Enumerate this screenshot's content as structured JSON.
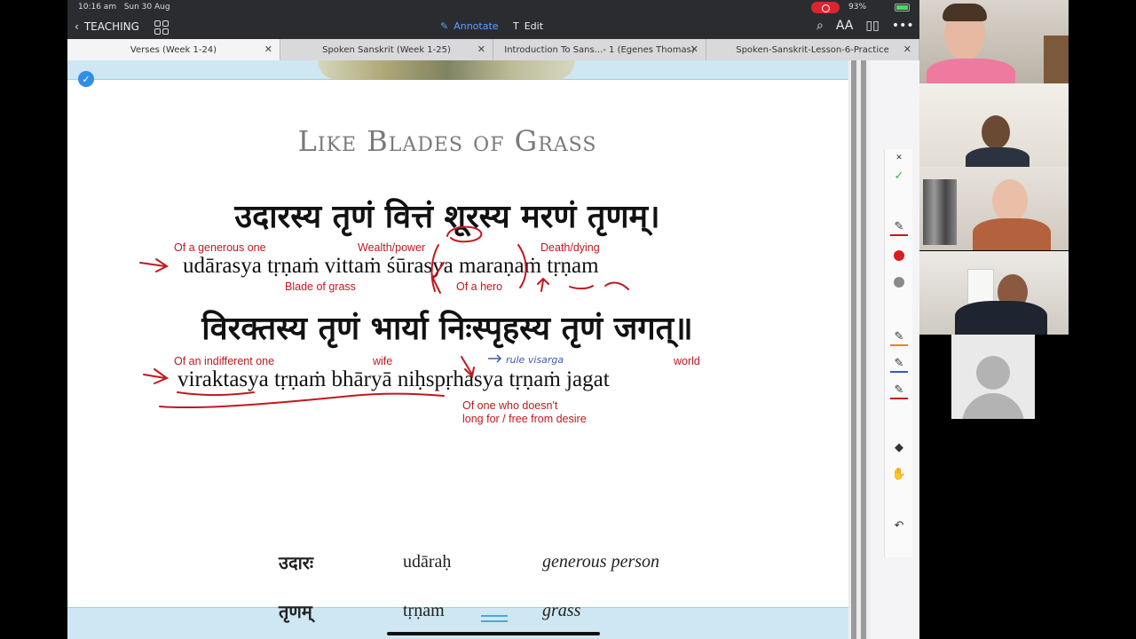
{
  "status": {
    "time": "10:16 am",
    "date": "Sun 30 Aug",
    "battery": "93%"
  },
  "toolbar": {
    "back_label": "TEACHING",
    "annotate_label": "Annotate",
    "edit_label": "Edit"
  },
  "tabs": [
    {
      "label": "Verses (Week 1-24)",
      "active": true
    },
    {
      "label": "Spoken Sanskrit (Week 1-25)",
      "active": false
    },
    {
      "label": "Introduction To Sans...- 1 (Egenes Thomas)",
      "active": false
    },
    {
      "label": "Spoken-Sanskrit-Lesson-6-Practice",
      "active": false
    }
  ],
  "page": {
    "title": "Like Blades of Grass",
    "line1_deva": "उदारस्य तृणं वित्तं शूरस्य मरणं तृणम्।",
    "line1_translit": "udārasya tṛṇaṁ vittaṁ śūrasya maraṇaṁ tṛṇam",
    "line2_deva": "विरक्तस्य तृणं भार्या निःस्पृहस्य तृणं जगत्॥",
    "line2_translit": "viraktasya tṛṇaṁ bhāryā niḥspṛhasya tṛṇaṁ jagat"
  },
  "annotations": {
    "generous": "Of a generous one",
    "wealth": "Wealth/power",
    "death": "Death/dying",
    "blade": "Blade of grass",
    "hero": "Of a hero",
    "indifferent": "Of an indifferent one",
    "wife": "wife",
    "world": "world",
    "rule": "rule visarga",
    "desire_1": "Of one who doesn't",
    "desire_2": "long for / free from desire"
  },
  "vocab": [
    {
      "deva": "उदारः",
      "translit": "udāraḥ",
      "meaning": "generous person"
    },
    {
      "deva": "तृणम्",
      "translit": "tṛṇam",
      "meaning": "grass"
    }
  ],
  "colors": {
    "annotation_red": "#c2181f",
    "accent_blue": "#2f8fe6",
    "toolbar_dark": "#2b2c30"
  }
}
